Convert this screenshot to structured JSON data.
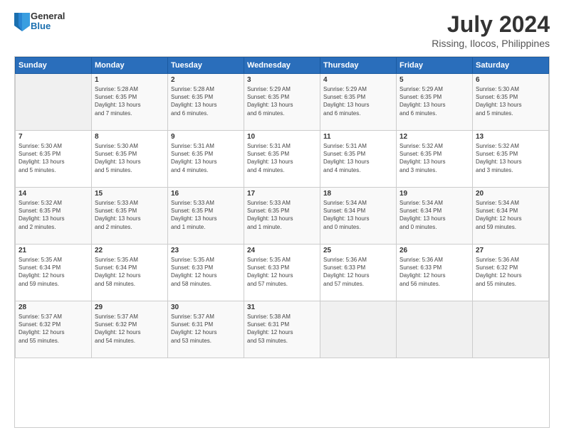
{
  "header": {
    "logo": {
      "line1": "General",
      "line2": "Blue"
    },
    "title": "July 2024",
    "subtitle": "Rissing, Ilocos, Philippines"
  },
  "calendar": {
    "weekdays": [
      "Sunday",
      "Monday",
      "Tuesday",
      "Wednesday",
      "Thursday",
      "Friday",
      "Saturday"
    ],
    "weeks": [
      [
        {
          "day": "",
          "info": ""
        },
        {
          "day": "1",
          "info": "Sunrise: 5:28 AM\nSunset: 6:35 PM\nDaylight: 13 hours\nand 7 minutes."
        },
        {
          "day": "2",
          "info": "Sunrise: 5:28 AM\nSunset: 6:35 PM\nDaylight: 13 hours\nand 6 minutes."
        },
        {
          "day": "3",
          "info": "Sunrise: 5:29 AM\nSunset: 6:35 PM\nDaylight: 13 hours\nand 6 minutes."
        },
        {
          "day": "4",
          "info": "Sunrise: 5:29 AM\nSunset: 6:35 PM\nDaylight: 13 hours\nand 6 minutes."
        },
        {
          "day": "5",
          "info": "Sunrise: 5:29 AM\nSunset: 6:35 PM\nDaylight: 13 hours\nand 6 minutes."
        },
        {
          "day": "6",
          "info": "Sunrise: 5:30 AM\nSunset: 6:35 PM\nDaylight: 13 hours\nand 5 minutes."
        }
      ],
      [
        {
          "day": "7",
          "info": "Sunrise: 5:30 AM\nSunset: 6:35 PM\nDaylight: 13 hours\nand 5 minutes."
        },
        {
          "day": "8",
          "info": "Sunrise: 5:30 AM\nSunset: 6:35 PM\nDaylight: 13 hours\nand 5 minutes."
        },
        {
          "day": "9",
          "info": "Sunrise: 5:31 AM\nSunset: 6:35 PM\nDaylight: 13 hours\nand 4 minutes."
        },
        {
          "day": "10",
          "info": "Sunrise: 5:31 AM\nSunset: 6:35 PM\nDaylight: 13 hours\nand 4 minutes."
        },
        {
          "day": "11",
          "info": "Sunrise: 5:31 AM\nSunset: 6:35 PM\nDaylight: 13 hours\nand 4 minutes."
        },
        {
          "day": "12",
          "info": "Sunrise: 5:32 AM\nSunset: 6:35 PM\nDaylight: 13 hours\nand 3 minutes."
        },
        {
          "day": "13",
          "info": "Sunrise: 5:32 AM\nSunset: 6:35 PM\nDaylight: 13 hours\nand 3 minutes."
        }
      ],
      [
        {
          "day": "14",
          "info": "Sunrise: 5:32 AM\nSunset: 6:35 PM\nDaylight: 13 hours\nand 2 minutes."
        },
        {
          "day": "15",
          "info": "Sunrise: 5:33 AM\nSunset: 6:35 PM\nDaylight: 13 hours\nand 2 minutes."
        },
        {
          "day": "16",
          "info": "Sunrise: 5:33 AM\nSunset: 6:35 PM\nDaylight: 13 hours\nand 1 minute."
        },
        {
          "day": "17",
          "info": "Sunrise: 5:33 AM\nSunset: 6:35 PM\nDaylight: 13 hours\nand 1 minute."
        },
        {
          "day": "18",
          "info": "Sunrise: 5:34 AM\nSunset: 6:34 PM\nDaylight: 13 hours\nand 0 minutes."
        },
        {
          "day": "19",
          "info": "Sunrise: 5:34 AM\nSunset: 6:34 PM\nDaylight: 13 hours\nand 0 minutes."
        },
        {
          "day": "20",
          "info": "Sunrise: 5:34 AM\nSunset: 6:34 PM\nDaylight: 12 hours\nand 59 minutes."
        }
      ],
      [
        {
          "day": "21",
          "info": "Sunrise: 5:35 AM\nSunset: 6:34 PM\nDaylight: 12 hours\nand 59 minutes."
        },
        {
          "day": "22",
          "info": "Sunrise: 5:35 AM\nSunset: 6:34 PM\nDaylight: 12 hours\nand 58 minutes."
        },
        {
          "day": "23",
          "info": "Sunrise: 5:35 AM\nSunset: 6:33 PM\nDaylight: 12 hours\nand 58 minutes."
        },
        {
          "day": "24",
          "info": "Sunrise: 5:35 AM\nSunset: 6:33 PM\nDaylight: 12 hours\nand 57 minutes."
        },
        {
          "day": "25",
          "info": "Sunrise: 5:36 AM\nSunset: 6:33 PM\nDaylight: 12 hours\nand 57 minutes."
        },
        {
          "day": "26",
          "info": "Sunrise: 5:36 AM\nSunset: 6:33 PM\nDaylight: 12 hours\nand 56 minutes."
        },
        {
          "day": "27",
          "info": "Sunrise: 5:36 AM\nSunset: 6:32 PM\nDaylight: 12 hours\nand 55 minutes."
        }
      ],
      [
        {
          "day": "28",
          "info": "Sunrise: 5:37 AM\nSunset: 6:32 PM\nDaylight: 12 hours\nand 55 minutes."
        },
        {
          "day": "29",
          "info": "Sunrise: 5:37 AM\nSunset: 6:32 PM\nDaylight: 12 hours\nand 54 minutes."
        },
        {
          "day": "30",
          "info": "Sunrise: 5:37 AM\nSunset: 6:31 PM\nDaylight: 12 hours\nand 53 minutes."
        },
        {
          "day": "31",
          "info": "Sunrise: 5:38 AM\nSunset: 6:31 PM\nDaylight: 12 hours\nand 53 minutes."
        },
        {
          "day": "",
          "info": ""
        },
        {
          "day": "",
          "info": ""
        },
        {
          "day": "",
          "info": ""
        }
      ]
    ]
  }
}
